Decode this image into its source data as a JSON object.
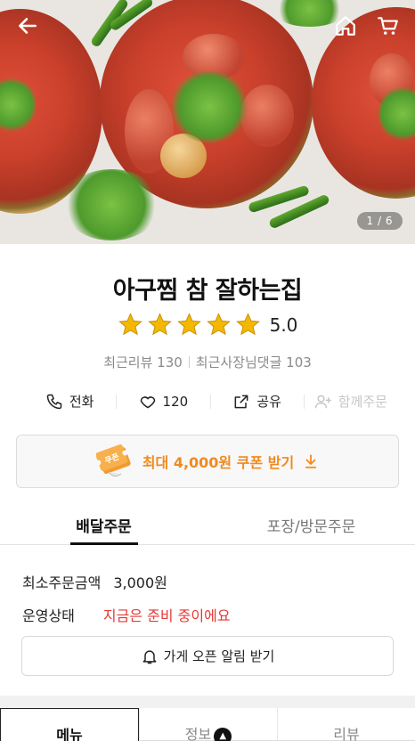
{
  "hero": {
    "image_counter": "1 / 6",
    "icons": {
      "back": "arrow-left-icon",
      "home": "home-icon",
      "cart": "cart-icon"
    }
  },
  "store": {
    "name": "아구찜 참 잘하는집",
    "rating": "5.0",
    "stars_filled": 5,
    "recent_reviews_label": "최근리뷰 130",
    "owner_replies_label": "최근사장님댓글 103"
  },
  "actions": [
    {
      "id": "call",
      "label": "전화",
      "icon": "phone-icon",
      "enabled": true
    },
    {
      "id": "like",
      "label": "120",
      "icon": "heart-icon",
      "enabled": true
    },
    {
      "id": "share",
      "label": "공유",
      "icon": "share-icon",
      "enabled": true
    },
    {
      "id": "group",
      "label": "함께주문",
      "icon": "add-user-icon",
      "enabled": false
    }
  ],
  "coupon": {
    "label": "최대 4,000원 쿠폰 받기",
    "ticket_text": "쿠폰",
    "icon": "download-arrow-icon"
  },
  "order_tabs": [
    {
      "label": "배달주문",
      "active": true
    },
    {
      "label": "포장/방문주문",
      "active": false
    }
  ],
  "order_info": {
    "min_order_label": "최소주문금액",
    "min_order_value": "3,000원",
    "status_label": "운영상태",
    "status_value": "지금은 준비 중이에요"
  },
  "notify_button": {
    "label": "가게 오픈 알림 받기",
    "icon": "bell-icon"
  },
  "bottom_tabs": [
    {
      "label": "메뉴",
      "active": true
    },
    {
      "label": "정보",
      "active": false,
      "badge_icon": "megaphone-icon"
    },
    {
      "label": "리뷰",
      "active": false
    }
  ],
  "colors": {
    "star": "#f5b800",
    "accent_orange": "#f08a1e",
    "status_red": "#e53935"
  }
}
